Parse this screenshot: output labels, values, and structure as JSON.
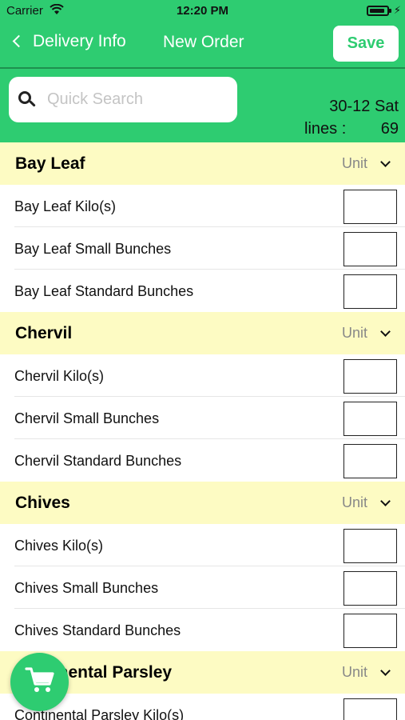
{
  "status_bar": {
    "carrier": "Carrier",
    "time": "12:20 PM"
  },
  "nav": {
    "back_label": "Delivery Info",
    "title": "New Order",
    "save_label": "Save"
  },
  "search": {
    "placeholder": "Quick Search",
    "value": ""
  },
  "summary": {
    "date": "30-12 Sat",
    "lines_label": "lines :",
    "lines_count": "69"
  },
  "colors": {
    "accent": "#2ecc71",
    "section_bg": "#fdfbc3"
  },
  "sections": [
    {
      "title": "Bay Leaf",
      "unit_label": "Unit",
      "items": [
        {
          "label": "Bay Leaf Kilo(s)",
          "qty": ""
        },
        {
          "label": "Bay Leaf Small Bunches",
          "qty": ""
        },
        {
          "label": "Bay Leaf Standard Bunches",
          "qty": ""
        }
      ]
    },
    {
      "title": "Chervil",
      "unit_label": "Unit",
      "items": [
        {
          "label": "Chervil Kilo(s)",
          "qty": ""
        },
        {
          "label": "Chervil Small Bunches",
          "qty": ""
        },
        {
          "label": "Chervil Standard Bunches",
          "qty": ""
        }
      ]
    },
    {
      "title": "Chives",
      "unit_label": "Unit",
      "items": [
        {
          "label": "Chives Kilo(s)",
          "qty": ""
        },
        {
          "label": "Chives Small Bunches",
          "qty": ""
        },
        {
          "label": "Chives Standard Bunches",
          "qty": ""
        }
      ]
    },
    {
      "title": "Continental Parsley",
      "unit_label": "Unit",
      "items": [
        {
          "label": "Continental Parsley Kilo(s)",
          "qty": ""
        }
      ]
    }
  ],
  "icons": {
    "back": "chevron-left-icon",
    "search": "search-icon",
    "unit": "chevron-down-icon",
    "cart": "cart-icon"
  }
}
